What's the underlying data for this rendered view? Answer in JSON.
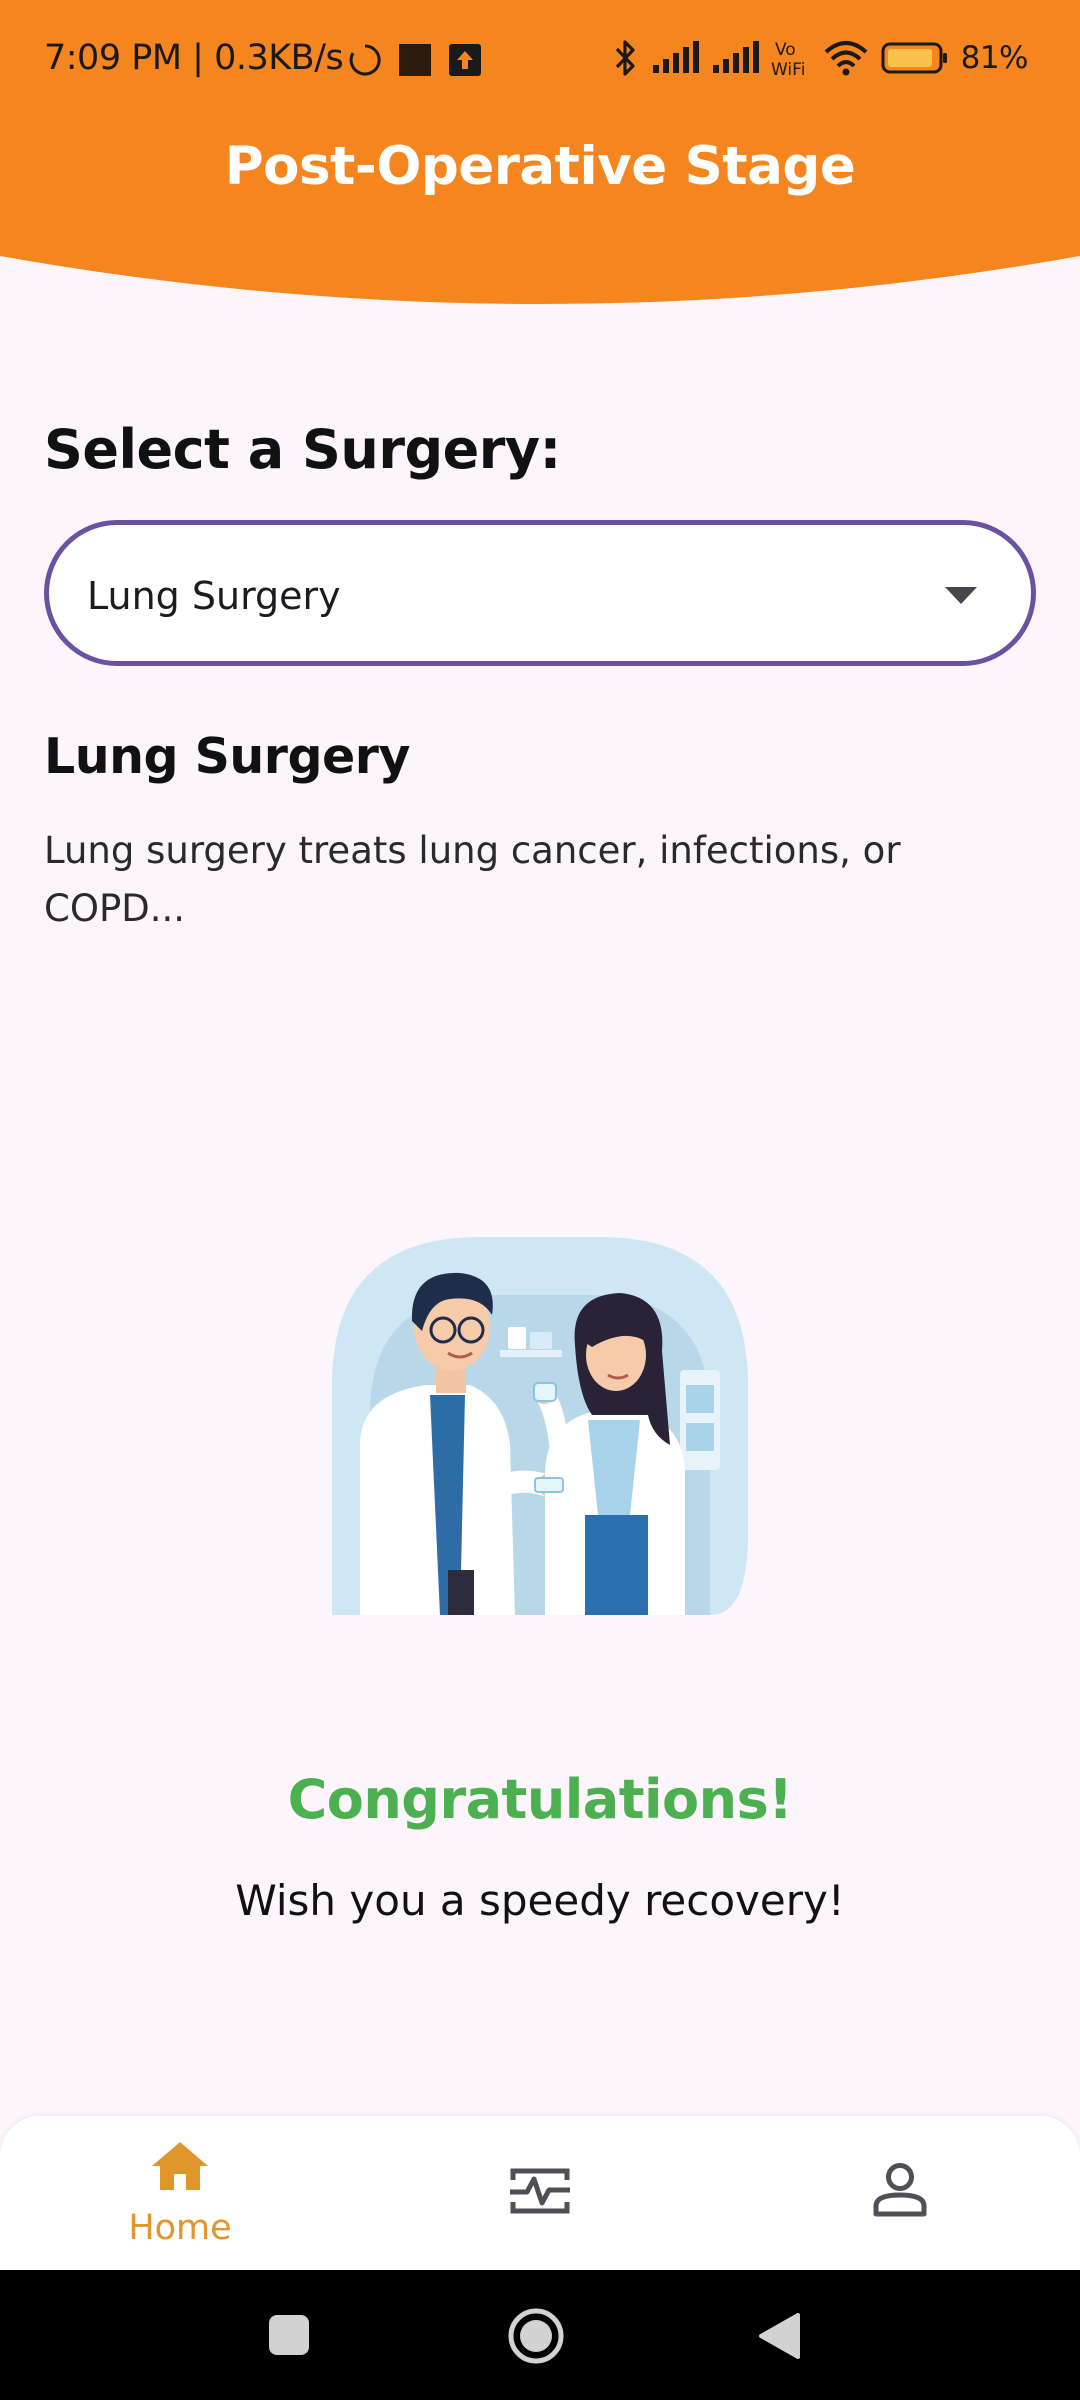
{
  "status_bar": {
    "time_speed": "7:09 PM | 0.3KB/s",
    "battery": "81%"
  },
  "header": {
    "title": "Post-Operative Stage",
    "color": "#f5861f"
  },
  "select": {
    "label": "Select a Surgery:",
    "value": "Lung Surgery"
  },
  "surgery": {
    "title": "Lung Surgery",
    "description": "Lung surgery treats lung cancer, infections, or COPD..."
  },
  "illustration": {
    "icon": "doctors-illustration"
  },
  "message": {
    "title": "Congratulations!",
    "subtitle": "Wish you a speedy recovery!",
    "title_color": "#4caf50"
  },
  "bottom_nav": {
    "items": [
      {
        "label": "Home",
        "icon": "home-icon",
        "active": true
      },
      {
        "label": "",
        "icon": "activity-icon",
        "active": false
      },
      {
        "label": "",
        "icon": "profile-icon",
        "active": false
      }
    ],
    "active_color": "#e0962a"
  },
  "system_nav": {
    "buttons": [
      "recents-button",
      "home-button",
      "back-button"
    ]
  }
}
